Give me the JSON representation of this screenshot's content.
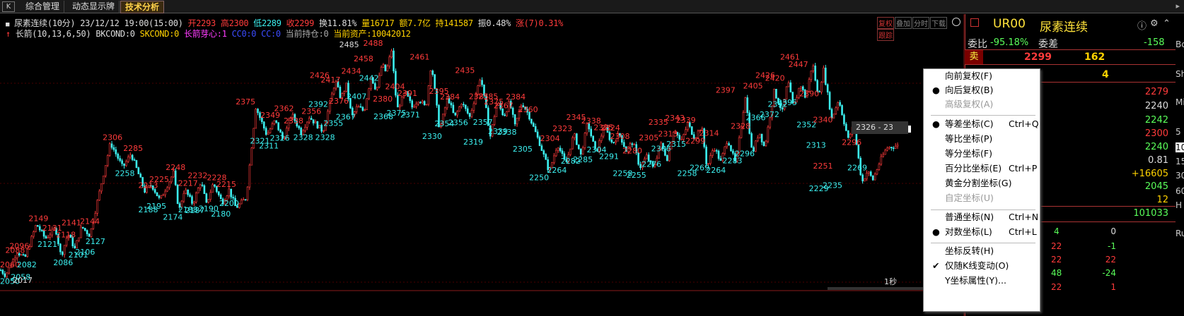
{
  "tabs": [
    {
      "label": "综合管理"
    },
    {
      "label": "动态显示牌"
    },
    {
      "label": "技术分析",
      "active": true
    }
  ],
  "k_btn": "K",
  "info_line1": {
    "name": "尿素连续(10分)",
    "datetime": "23/12/12 19:00(15:00)",
    "open": "开2293",
    "high": "高2300",
    "low": "低2289",
    "close": "收2299",
    "turnover": "换11.81%",
    "volume": "量16717",
    "amount": "额7.7亿",
    "hold": "持141587",
    "amp": "振0.48%",
    "change": "涨(7)0.31%"
  },
  "info_line2": {
    "name": "长箭(10,13,6,50)",
    "bkcond": "BKCOND:0",
    "skcond": "SKCOND:0",
    "sprout": "长箭芽心:1",
    "cc0": "CC0:0",
    "cc": "CC:0",
    "cur_pos": "当前持仓:0",
    "cur_asset": "当前资产:10042012"
  },
  "chart_buttons": [
    "复权",
    "叠加",
    "分时",
    "下载",
    "跟踪"
  ],
  "year_label": "2017",
  "sec_label": "1秒",
  "range_label": "2326 - 23",
  "right_panel": {
    "title": "UR00",
    "name": "尿素连续",
    "weibi_label": "委比",
    "weibi": "-95.18%",
    "weicha_label": "委差",
    "weicha": "-158",
    "sell_label": "卖",
    "sell_price": "2299",
    "sell_vol": "162",
    "buy_vol": "4",
    "stats": [
      "2279",
      "2240",
      "2242",
      "2300",
      "2240",
      "0.81",
      "+16605",
      "2045",
      "12",
      "101033"
    ],
    "ticks": [
      {
        "a": "4",
        "b": "0"
      },
      {
        "a": "22",
        "b": "-1"
      },
      {
        "a": "22",
        "b": "22"
      },
      {
        "a": "48",
        "b": "-24"
      },
      {
        "a": "22",
        "b": "1"
      }
    ]
  },
  "right_strip": [
    "Bc",
    "Sh",
    "Mi",
    "5",
    "10",
    "15",
    "30",
    "60",
    "H",
    "Ru"
  ],
  "context_menu": [
    {
      "label": "向前复权(F)",
      "shortcut": "",
      "mark": "",
      "disabled": false
    },
    {
      "label": "向后复权(B)",
      "shortcut": "",
      "mark": "dot",
      "disabled": false
    },
    {
      "label": "高级复权(A)",
      "shortcut": "",
      "mark": "",
      "disabled": true
    },
    {
      "sep": true
    },
    {
      "label": "等差坐标(C)",
      "shortcut": "Ctrl+Q",
      "mark": "dot",
      "disabled": false
    },
    {
      "label": "等比坐标(P)",
      "shortcut": "",
      "mark": "",
      "disabled": false
    },
    {
      "label": "等分坐标(F)",
      "shortcut": "",
      "mark": "",
      "disabled": false
    },
    {
      "label": "百分比坐标(E)",
      "shortcut": "Ctrl+P",
      "mark": "",
      "disabled": false
    },
    {
      "label": "黄金分割坐标(G)",
      "shortcut": "",
      "mark": "",
      "disabled": false
    },
    {
      "label": "自定坐标(U)",
      "shortcut": "",
      "mark": "",
      "disabled": true
    },
    {
      "sep": true
    },
    {
      "label": "普通坐标(N)",
      "shortcut": "Ctrl+N",
      "mark": "",
      "disabled": false
    },
    {
      "label": "对数坐标(L)",
      "shortcut": "Ctrl+L",
      "mark": "dot",
      "disabled": false
    },
    {
      "sep": true
    },
    {
      "label": "坐标反转(H)",
      "shortcut": "",
      "mark": "",
      "disabled": false
    },
    {
      "label": "仅随K线变动(O)",
      "shortcut": "",
      "mark": "check",
      "disabled": false
    },
    {
      "label": "Y坐标属性(Y)...",
      "shortcut": "",
      "mark": "",
      "disabled": false
    }
  ],
  "chart_data": {
    "type": "candlestick",
    "ylim": [
      2030,
      2500
    ],
    "colors": {
      "up": "#ff3b3b",
      "down": "#3cf0f0",
      "high_label": "#ff3b3b",
      "low_label": "#3cf0f0"
    },
    "anchors": [
      {
        "i": 0,
        "p": 2060
      },
      {
        "i": 7,
        "p": 2050
      },
      {
        "i": 24,
        "p": 2096
      },
      {
        "i": 35,
        "p": 2082
      },
      {
        "i": 52,
        "p": 2149
      },
      {
        "i": 65,
        "p": 2121
      },
      {
        "i": 80,
        "p": 2141
      },
      {
        "i": 88,
        "p": 2086
      },
      {
        "i": 98,
        "p": 2131
      },
      {
        "i": 108,
        "p": 2101
      },
      {
        "i": 118,
        "p": 2144
      },
      {
        "i": 130,
        "p": 2127
      },
      {
        "i": 160,
        "p": 2306
      },
      {
        "i": 178,
        "p": 2258
      },
      {
        "i": 190,
        "p": 2285
      },
      {
        "i": 210,
        "p": 2213
      },
      {
        "i": 220,
        "p": 2225
      },
      {
        "i": 232,
        "p": 2195
      },
      {
        "i": 252,
        "p": 2248
      },
      {
        "i": 260,
        "p": 2174
      },
      {
        "i": 268,
        "p": 2217
      },
      {
        "i": 280,
        "p": 2188
      },
      {
        "i": 292,
        "p": 2232
      },
      {
        "i": 300,
        "p": 2187
      },
      {
        "i": 310,
        "p": 2228
      },
      {
        "i": 323,
        "p": 2190
      },
      {
        "i": 333,
        "p": 2215
      },
      {
        "i": 343,
        "p": 2180
      },
      {
        "i": 358,
        "p": 2200
      },
      {
        "i": 372,
        "p": 2375
      },
      {
        "i": 388,
        "p": 2321
      },
      {
        "i": 400,
        "p": 2349
      },
      {
        "i": 412,
        "p": 2311
      },
      {
        "i": 424,
        "p": 2362
      },
      {
        "i": 438,
        "p": 2326
      },
      {
        "i": 450,
        "p": 2356
      },
      {
        "i": 470,
        "p": 2328
      },
      {
        "i": 488,
        "p": 2426
      },
      {
        "i": 496,
        "p": 2392
      },
      {
        "i": 504,
        "p": 2417
      },
      {
        "i": 512,
        "p": 2355
      },
      {
        "i": 520,
        "p": 2376
      },
      {
        "i": 530,
        "p": 2367
      },
      {
        "i": 540,
        "p": 2434
      },
      {
        "i": 548,
        "p": 2407
      },
      {
        "i": 556,
        "p": 2458
      },
      {
        "i": 562,
        "p": 2442
      },
      {
        "i": 570,
        "p": 2485
      },
      {
        "i": 578,
        "p": 2370
      },
      {
        "i": 590,
        "p": 2404
      },
      {
        "i": 600,
        "p": 2375
      },
      {
        "i": 610,
        "p": 2391
      },
      {
        "i": 620,
        "p": 2373
      },
      {
        "i": 628,
        "p": 2461
      },
      {
        "i": 640,
        "p": 2330
      },
      {
        "i": 652,
        "p": 2395
      },
      {
        "i": 662,
        "p": 2354
      },
      {
        "i": 672,
        "p": 2384
      },
      {
        "i": 684,
        "p": 2356
      },
      {
        "i": 700,
        "p": 2435
      },
      {
        "i": 714,
        "p": 2319
      },
      {
        "i": 724,
        "p": 2385
      },
      {
        "i": 734,
        "p": 2357
      },
      {
        "i": 742,
        "p": 2385
      },
      {
        "i": 750,
        "p": 2338
      },
      {
        "i": 760,
        "p": 2384
      },
      {
        "i": 770,
        "p": 2360
      },
      {
        "i": 786,
        "p": 2305
      },
      {
        "i": 800,
        "p": 2250
      },
      {
        "i": 812,
        "p": 2304
      },
      {
        "i": 824,
        "p": 2264
      },
      {
        "i": 836,
        "p": 2323
      },
      {
        "i": 846,
        "p": 2282
      },
      {
        "i": 856,
        "p": 2345
      },
      {
        "i": 868,
        "p": 2285
      },
      {
        "i": 880,
        "p": 2338
      },
      {
        "i": 892,
        "p": 2304
      },
      {
        "i": 902,
        "p": 2324
      },
      {
        "i": 912,
        "p": 2291
      },
      {
        "i": 922,
        "p": 2308
      },
      {
        "i": 932,
        "p": 2258
      },
      {
        "i": 942,
        "p": 2280
      },
      {
        "i": 952,
        "p": 2255
      },
      {
        "i": 962,
        "p": 2305
      },
      {
        "i": 972,
        "p": 2276
      },
      {
        "i": 982,
        "p": 2335
      },
      {
        "i": 992,
        "p": 2306
      },
      {
        "i": 1002,
        "p": 2343
      },
      {
        "i": 1012,
        "p": 2315
      },
      {
        "i": 1022,
        "p": 2339
      },
      {
        "i": 1030,
        "p": 2258
      },
      {
        "i": 1040,
        "p": 2299
      },
      {
        "i": 1050,
        "p": 2269
      },
      {
        "i": 1060,
        "p": 2314
      },
      {
        "i": 1072,
        "p": 2264
      },
      {
        "i": 1086,
        "p": 2397
      },
      {
        "i": 1096,
        "p": 2283
      },
      {
        "i": 1106,
        "p": 2328
      },
      {
        "i": 1114,
        "p": 2296
      },
      {
        "i": 1128,
        "p": 2405
      },
      {
        "i": 1140,
        "p": 2366
      },
      {
        "i": 1148,
        "p": 2426
      },
      {
        "i": 1156,
        "p": 2372
      },
      {
        "i": 1166,
        "p": 2420
      },
      {
        "i": 1174,
        "p": 2392
      },
      {
        "i": 1184,
        "p": 2461
      },
      {
        "i": 1192,
        "p": 2395
      },
      {
        "i": 1200,
        "p": 2447
      },
      {
        "i": 1212,
        "p": 2352
      },
      {
        "i": 1222,
        "p": 2390
      },
      {
        "i": 1236,
        "p": 2313
      },
      {
        "i": 1244,
        "p": 2340
      },
      {
        "i": 1256,
        "p": 2229
      },
      {
        "i": 1264,
        "p": 2251
      },
      {
        "i": 1272,
        "p": 2235
      },
      {
        "i": 1282,
        "p": 2269
      },
      {
        "i": 1292,
        "p": 2296
      },
      {
        "i": 1305,
        "p": 2300
      }
    ],
    "labels": [
      {
        "i": 0,
        "v": "2060",
        "hi": true
      },
      {
        "i": 8,
        "v": "2050",
        "hi": false
      },
      {
        "i": 24,
        "v": "2096",
        "hi": true
      },
      {
        "i": 18,
        "v": "2088",
        "hi": true
      },
      {
        "i": 35,
        "v": "2082",
        "hi": false
      },
      {
        "i": 26,
        "v": "2058",
        "hi": false
      },
      {
        "i": 52,
        "v": "2149",
        "hi": true
      },
      {
        "i": 65,
        "v": "2121",
        "hi": false
      },
      {
        "i": 72,
        "v": "2131",
        "hi": true
      },
      {
        "i": 88,
        "v": "2086",
        "hi": false
      },
      {
        "i": 100,
        "v": "2141",
        "hi": true
      },
      {
        "i": 92,
        "v": "2118",
        "hi": true
      },
      {
        "i": 110,
        "v": "2101",
        "hi": false
      },
      {
        "i": 120,
        "v": "2106",
        "hi": false
      },
      {
        "i": 127,
        "v": "2144",
        "hi": true
      },
      {
        "i": 135,
        "v": "2127",
        "hi": false
      },
      {
        "i": 160,
        "v": "2306",
        "hi": true
      },
      {
        "i": 178,
        "v": "2258",
        "hi": false
      },
      {
        "i": 190,
        "v": "2285",
        "hi": true
      },
      {
        "i": 212,
        "v": "2213",
        "hi": true
      },
      {
        "i": 228,
        "v": "2225",
        "hi": true
      },
      {
        "i": 212,
        "v": "2188",
        "hi": false
      },
      {
        "i": 224,
        "v": "2195",
        "hi": false
      },
      {
        "i": 252,
        "v": "2248",
        "hi": true
      },
      {
        "i": 248,
        "v": "2174",
        "hi": false
      },
      {
        "i": 270,
        "v": "2217",
        "hi": true
      },
      {
        "i": 270,
        "v": "2188",
        "hi": false
      },
      {
        "i": 284,
        "v": "2232",
        "hi": true
      },
      {
        "i": 280,
        "v": "2187",
        "hi": false
      },
      {
        "i": 312,
        "v": "2228",
        "hi": true
      },
      {
        "i": 300,
        "v": "2190",
        "hi": false
      },
      {
        "i": 326,
        "v": "2215",
        "hi": true
      },
      {
        "i": 318,
        "v": "2180",
        "hi": false
      },
      {
        "i": 330,
        "v": "2200",
        "hi": false
      },
      {
        "i": 354,
        "v": "2375",
        "hi": true
      },
      {
        "i": 375,
        "v": "2321",
        "hi": false
      },
      {
        "i": 390,
        "v": "2349",
        "hi": true
      },
      {
        "i": 388,
        "v": "2311",
        "hi": false
      },
      {
        "i": 410,
        "v": "2362",
        "hi": true
      },
      {
        "i": 404,
        "v": "2326",
        "hi": false
      },
      {
        "i": 424,
        "v": "2338",
        "hi": true
      },
      {
        "i": 438,
        "v": "2328",
        "hi": false
      },
      {
        "i": 450,
        "v": "2356",
        "hi": true
      },
      {
        "i": 470,
        "v": "2328",
        "hi": false
      },
      {
        "i": 460,
        "v": "2392",
        "hi": false
      },
      {
        "i": 462,
        "v": "2426",
        "hi": true
      },
      {
        "i": 478,
        "v": "2417",
        "hi": true
      },
      {
        "i": 482,
        "v": "2355",
        "hi": false
      },
      {
        "i": 490,
        "v": "2376",
        "hi": true
      },
      {
        "i": 500,
        "v": "2367",
        "hi": false
      },
      {
        "i": 508,
        "v": "2434",
        "hi": true
      },
      {
        "i": 516,
        "v": "2407",
        "hi": false
      },
      {
        "i": 526,
        "v": "2458",
        "hi": true
      },
      {
        "i": 534,
        "v": "2442",
        "hi": false
      },
      {
        "i": 540,
        "v": "2488",
        "hi": true
      },
      {
        "i": 505,
        "v": "2485",
        "hi": true,
        "dark": true
      },
      {
        "i": 554,
        "v": "2380",
        "hi": true
      },
      {
        "i": 555,
        "v": "2368",
        "hi": false
      },
      {
        "i": 572,
        "v": "2404",
        "hi": true
      },
      {
        "i": 574,
        "v": "2375",
        "hi": false
      },
      {
        "i": 590,
        "v": "2391",
        "hi": true
      },
      {
        "i": 594,
        "v": "2371",
        "hi": false
      },
      {
        "i": 608,
        "v": "2461",
        "hi": true
      },
      {
        "i": 626,
        "v": "2330",
        "hi": false
      },
      {
        "i": 636,
        "v": "2395",
        "hi": true
      },
      {
        "i": 644,
        "v": "2354",
        "hi": false
      },
      {
        "i": 652,
        "v": "2384",
        "hi": true
      },
      {
        "i": 664,
        "v": "2356",
        "hi": false
      },
      {
        "i": 674,
        "v": "2435",
        "hi": true
      },
      {
        "i": 686,
        "v": "2319",
        "hi": false
      },
      {
        "i": 694,
        "v": "2385",
        "hi": true
      },
      {
        "i": 700,
        "v": "2357",
        "hi": false
      },
      {
        "i": 708,
        "v": "2385",
        "hi": true
      },
      {
        "i": 716,
        "v": "2375",
        "hi": true
      },
      {
        "i": 722,
        "v": "2339",
        "hi": false
      },
      {
        "i": 730,
        "v": "2367",
        "hi": true
      },
      {
        "i": 735,
        "v": "2338",
        "hi": false
      },
      {
        "i": 748,
        "v": "2384",
        "hi": true
      },
      {
        "i": 766,
        "v": "2360",
        "hi": true
      },
      {
        "i": 758,
        "v": "2305",
        "hi": false
      },
      {
        "i": 782,
        "v": "2250",
        "hi": false
      },
      {
        "i": 798,
        "v": "2304",
        "hi": true
      },
      {
        "i": 808,
        "v": "2264",
        "hi": false
      },
      {
        "i": 816,
        "v": "2323",
        "hi": true
      },
      {
        "i": 828,
        "v": "2282",
        "hi": false
      },
      {
        "i": 836,
        "v": "2345",
        "hi": true
      },
      {
        "i": 846,
        "v": "2285",
        "hi": false
      },
      {
        "i": 858,
        "v": "2338",
        "hi": true
      },
      {
        "i": 866,
        "v": "2304",
        "hi": false
      },
      {
        "i": 876,
        "v": "2325",
        "hi": true
      },
      {
        "i": 886,
        "v": "2324",
        "hi": true
      },
      {
        "i": 884,
        "v": "2291",
        "hi": false
      },
      {
        "i": 900,
        "v": "2308",
        "hi": true
      },
      {
        "i": 904,
        "v": "2258",
        "hi": false
      },
      {
        "i": 918,
        "v": "2280",
        "hi": true
      },
      {
        "i": 924,
        "v": "2255",
        "hi": false
      },
      {
        "i": 942,
        "v": "2305",
        "hi": true
      },
      {
        "i": 946,
        "v": "2276",
        "hi": false
      },
      {
        "i": 956,
        "v": "2335",
        "hi": true
      },
      {
        "i": 960,
        "v": "2306",
        "hi": false
      },
      {
        "i": 970,
        "v": "2313",
        "hi": true
      },
      {
        "i": 980,
        "v": "2343",
        "hi": true
      },
      {
        "i": 982,
        "v": "2315",
        "hi": false
      },
      {
        "i": 996,
        "v": "2339",
        "hi": true
      },
      {
        "i": 998,
        "v": "2258",
        "hi": false
      },
      {
        "i": 1010,
        "v": "2299",
        "hi": true
      },
      {
        "i": 1016,
        "v": "2269",
        "hi": false
      },
      {
        "i": 1030,
        "v": "2314",
        "hi": true
      },
      {
        "i": 1040,
        "v": "2264",
        "hi": false
      },
      {
        "i": 1054,
        "v": "2397",
        "hi": true
      },
      {
        "i": 1064,
        "v": "2283",
        "hi": false
      },
      {
        "i": 1076,
        "v": "2328",
        "hi": true
      },
      {
        "i": 1082,
        "v": "2296",
        "hi": false
      },
      {
        "i": 1094,
        "v": "2405",
        "hi": true
      },
      {
        "i": 1098,
        "v": "2366",
        "hi": false
      },
      {
        "i": 1112,
        "v": "2426",
        "hi": true
      },
      {
        "i": 1118,
        "v": "2372",
        "hi": false
      },
      {
        "i": 1126,
        "v": "2420",
        "hi": true
      },
      {
        "i": 1130,
        "v": "2392",
        "hi": false
      },
      {
        "i": 1144,
        "v": "2395",
        "hi": false
      },
      {
        "i": 1148,
        "v": "2461",
        "hi": true
      },
      {
        "i": 1160,
        "v": "2447",
        "hi": true
      },
      {
        "i": 1176,
        "v": "2390",
        "hi": true
      },
      {
        "i": 1172,
        "v": "2352",
        "hi": false
      },
      {
        "i": 1196,
        "v": "2340",
        "hi": true
      },
      {
        "i": 1186,
        "v": "2313",
        "hi": false
      },
      {
        "i": 1196,
        "v": "2251",
        "hi": true
      },
      {
        "i": 1190,
        "v": "2229",
        "hi": false
      },
      {
        "i": 1210,
        "v": "2235",
        "hi": false
      },
      {
        "i": 1238,
        "v": "2296",
        "hi": true
      },
      {
        "i": 1246,
        "v": "2269",
        "hi": false
      }
    ]
  }
}
